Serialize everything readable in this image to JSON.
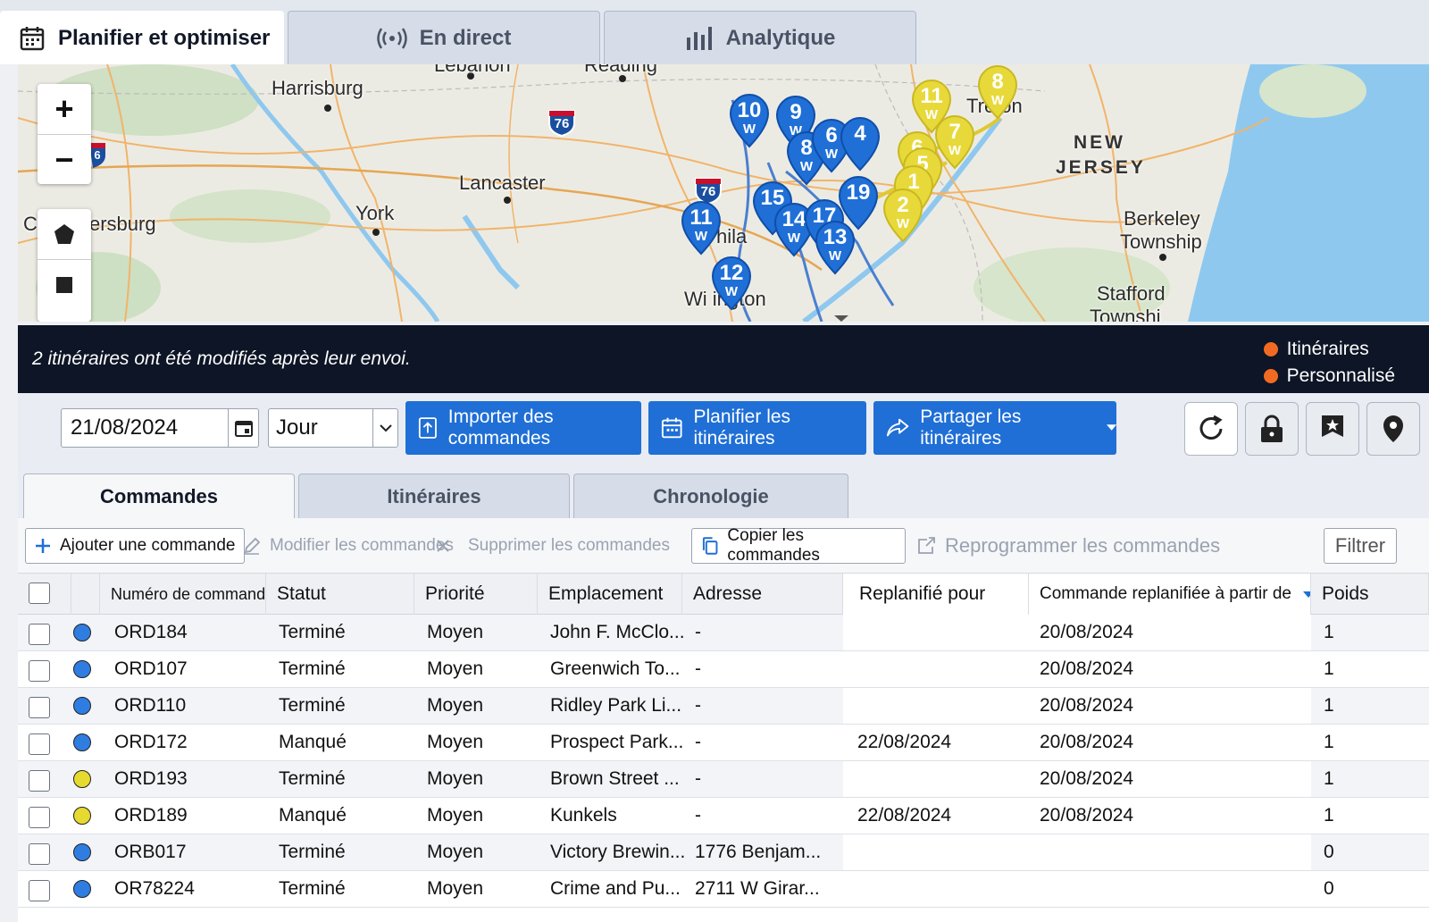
{
  "top_tabs": [
    {
      "label": "Planifier et optimiser",
      "icon": "calendar-icon"
    },
    {
      "label": "En direct",
      "icon": "broadcast-icon"
    },
    {
      "label": "Analytique",
      "icon": "bar-chart-icon"
    }
  ],
  "map": {
    "zoom_in": "+",
    "zoom_out": "−",
    "cities": {
      "harrisburg": "Harrisburg",
      "lancaster": "Lancaster",
      "york": "York",
      "chambersburg": "ersburg",
      "c_letter": "C",
      "reading": "Reading",
      "lebanon": "Lebanon",
      "trenton": "Tre  on",
      "philadelphia": "hila",
      "wilmington": "Wi  ington",
      "berkeley": "Berkeley",
      "township": "Township",
      "stafford": "Stafford",
      "stafford_twp": "Townshi"
    },
    "state_lines": [
      "NEW",
      "JERSEY"
    ],
    "shields": [
      "76",
      "76",
      "6"
    ],
    "pins": [
      {
        "n": "10",
        "w": "W",
        "color": "blue"
      },
      {
        "n": "9",
        "w": "W",
        "color": "blue"
      },
      {
        "n": "8",
        "w": "W",
        "color": "blue"
      },
      {
        "n": "6",
        "w": "W",
        "color": "blue"
      },
      {
        "n": "4",
        "w": "",
        "color": "blue"
      },
      {
        "n": "11",
        "w": "W",
        "color": "blue"
      },
      {
        "n": "15",
        "w": "",
        "color": "blue"
      },
      {
        "n": "14",
        "w": "W",
        "color": "blue"
      },
      {
        "n": "17",
        "w": "",
        "color": "blue"
      },
      {
        "n": "13",
        "w": "W",
        "color": "blue"
      },
      {
        "n": "12",
        "w": "W",
        "color": "blue"
      },
      {
        "n": "19",
        "w": "",
        "color": "blue"
      },
      {
        "n": "11",
        "w": "W",
        "color": "yellow"
      },
      {
        "n": "8",
        "w": "W",
        "color": "yellow"
      },
      {
        "n": "7",
        "w": "W",
        "color": "yellow"
      },
      {
        "n": "6",
        "w": "",
        "color": "yellow"
      },
      {
        "n": "5",
        "w": "",
        "color": "yellow"
      },
      {
        "n": "1",
        "w": "",
        "color": "yellow"
      },
      {
        "n": "2",
        "w": "W",
        "color": "yellow"
      }
    ]
  },
  "notice": {
    "message": "2 itinéraires ont été modifiés après leur envoi.",
    "legend": [
      "Itinéraires",
      "Personnalisé"
    ],
    "legend_color": "#f26a21"
  },
  "toolbar": {
    "date": "21/08/2024",
    "period": "Jour",
    "import_label": "Importer des commandes",
    "plan_label": "Planifier les itinéraires",
    "share_label": "Partager les itinéraires",
    "accent": "#1f6fd6"
  },
  "sub_tabs": [
    "Commandes",
    "Itinéraires",
    "Chronologie"
  ],
  "actions": {
    "add": "Ajouter une commande",
    "edit": "Modifier les commandes",
    "delete": "Supprimer les commandes",
    "copy": "Copier les commandes",
    "reschedule": "Reprogrammer les commandes",
    "filter": "Filtrer"
  },
  "table": {
    "headers": [
      "Numéro de commande",
      "Statut",
      "Priorité",
      "Emplacement",
      "Adresse",
      "Replanifié pour",
      "Commande replanifiée à partir de",
      "Poids"
    ],
    "rows": [
      {
        "id": "ORD184",
        "status": "Terminé",
        "priority": "Moyen",
        "location": "John F. McClo...",
        "address": "-",
        "rescheduled_for": "",
        "rescheduled_from": "20/08/2024",
        "weight": "1",
        "dot": "#2f7de1"
      },
      {
        "id": "ORD107",
        "status": "Terminé",
        "priority": "Moyen",
        "location": "Greenwich To...",
        "address": "-",
        "rescheduled_for": "",
        "rescheduled_from": "20/08/2024",
        "weight": "1",
        "dot": "#2f7de1"
      },
      {
        "id": "ORD110",
        "status": "Terminé",
        "priority": "Moyen",
        "location": "Ridley Park Li...",
        "address": "-",
        "rescheduled_for": "",
        "rescheduled_from": "20/08/2024",
        "weight": "1",
        "dot": "#2f7de1"
      },
      {
        "id": "ORD172",
        "status": "Manqué",
        "priority": "Moyen",
        "location": "Prospect Park...",
        "address": "-",
        "rescheduled_for": "22/08/2024",
        "rescheduled_from": "20/08/2024",
        "weight": "1",
        "dot": "#2f7de1"
      },
      {
        "id": "ORD193",
        "status": "Terminé",
        "priority": "Moyen",
        "location": "Brown Street ...",
        "address": "-",
        "rescheduled_for": "",
        "rescheduled_from": "20/08/2024",
        "weight": "1",
        "dot": "#e6d930"
      },
      {
        "id": "ORD189",
        "status": "Manqué",
        "priority": "Moyen",
        "location": "Kunkels",
        "address": "-",
        "rescheduled_for": "22/08/2024",
        "rescheduled_from": "20/08/2024",
        "weight": "1",
        "dot": "#e6d930"
      },
      {
        "id": "ORB017",
        "status": "Terminé",
        "priority": "Moyen",
        "location": "Victory Brewin...",
        "address": "1776 Benjam...",
        "rescheduled_for": "",
        "rescheduled_from": "",
        "weight": "0",
        "dot": "#2f7de1"
      },
      {
        "id": "OR78224",
        "status": "Terminé",
        "priority": "Moyen",
        "location": "Crime and Pu...",
        "address": "2711 W Girar...",
        "rescheduled_for": "",
        "rescheduled_from": "",
        "weight": "0",
        "dot": "#2f7de1"
      }
    ]
  }
}
